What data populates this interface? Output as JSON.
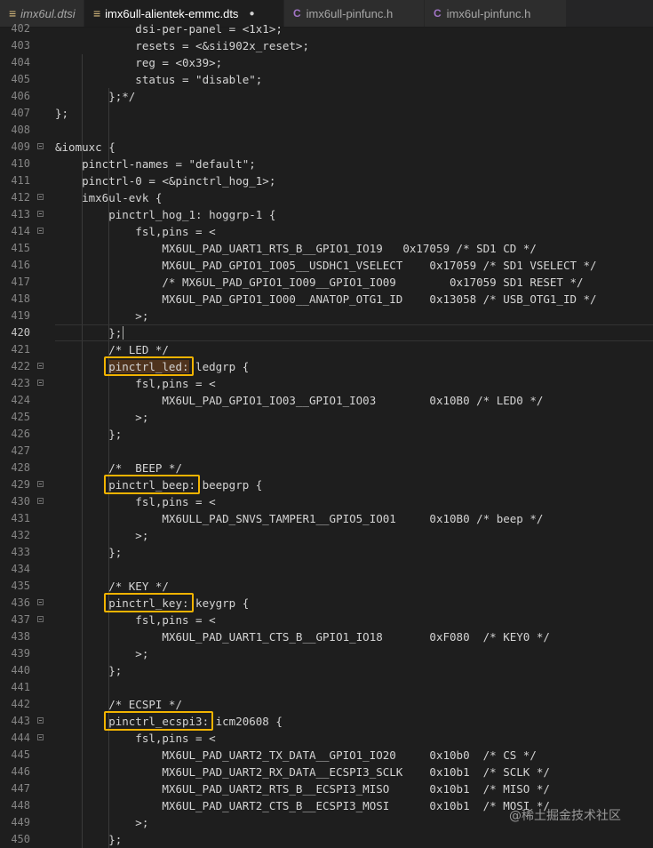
{
  "tabs": [
    {
      "label": "imx6ul.dtsi",
      "icon": "lines",
      "active": false,
      "italic": true
    },
    {
      "label": "imx6ull-alientek-emmc.dts",
      "icon": "lines",
      "active": true,
      "italic": false,
      "modified": true
    },
    {
      "label": "imx6ull-pinfunc.h",
      "icon": "c",
      "active": false,
      "italic": false
    },
    {
      "label": "imx6ul-pinfunc.h",
      "icon": "c",
      "active": false,
      "italic": false
    }
  ],
  "tab_icons": {
    "dts": "lines-icon",
    "header": "c-file-icon",
    "modified": "modified-dot-icon"
  },
  "editor": {
    "current_line": 420,
    "lines": [
      {
        "n": 402,
        "text": "            dsi-per-panel = <1x1>;"
      },
      {
        "n": 403,
        "text": "            resets = <&sii902x_reset>;"
      },
      {
        "n": 404,
        "text": "            reg = <0x39>;"
      },
      {
        "n": 405,
        "text": "            status = \"disable\";"
      },
      {
        "n": 406,
        "text": "        };*/"
      },
      {
        "n": 407,
        "text": "};"
      },
      {
        "n": 408,
        "text": ""
      },
      {
        "n": 409,
        "text": "&iomuxc {"
      },
      {
        "n": 410,
        "text": "    pinctrl-names = \"default\";"
      },
      {
        "n": 411,
        "text": "    pinctrl-0 = <&pinctrl_hog_1>;"
      },
      {
        "n": 412,
        "text": "    imx6ul-evk {"
      },
      {
        "n": 413,
        "text": "        pinctrl_hog_1: hoggrp-1 {"
      },
      {
        "n": 414,
        "text": "            fsl,pins = <"
      },
      {
        "n": 415,
        "text": "                MX6UL_PAD_UART1_RTS_B__GPIO1_IO19   0x17059 /* SD1 CD */"
      },
      {
        "n": 416,
        "text": "                MX6UL_PAD_GPIO1_IO05__USDHC1_VSELECT    0x17059 /* SD1 VSELECT */"
      },
      {
        "n": 417,
        "text": "                /* MX6UL_PAD_GPIO1_IO09__GPIO1_IO09        0x17059 SD1 RESET */"
      },
      {
        "n": 418,
        "text": "                MX6UL_PAD_GPIO1_IO00__ANATOP_OTG1_ID    0x13058 /* USB_OTG1_ID */"
      },
      {
        "n": 419,
        "text": "            >;"
      },
      {
        "n": 420,
        "text": "        };"
      },
      {
        "n": 421,
        "text": "        /* LED */"
      },
      {
        "n": 422,
        "text": "        pinctrl_led: ledgrp {"
      },
      {
        "n": 423,
        "text": "            fsl,pins = <"
      },
      {
        "n": 424,
        "text": "                MX6UL_PAD_GPIO1_IO03__GPIO1_IO03        0x10B0 /* LED0 */"
      },
      {
        "n": 425,
        "text": "            >;"
      },
      {
        "n": 426,
        "text": "        };"
      },
      {
        "n": 427,
        "text": ""
      },
      {
        "n": 428,
        "text": "        /*  BEEP */"
      },
      {
        "n": 429,
        "text": "        pinctrl_beep: beepgrp {"
      },
      {
        "n": 430,
        "text": "            fsl,pins = <"
      },
      {
        "n": 431,
        "text": "                MX6ULL_PAD_SNVS_TAMPER1__GPIO5_IO01     0x10B0 /* beep */"
      },
      {
        "n": 432,
        "text": "            >;"
      },
      {
        "n": 433,
        "text": "        };"
      },
      {
        "n": 434,
        "text": ""
      },
      {
        "n": 435,
        "text": "        /* KEY */"
      },
      {
        "n": 436,
        "text": "        pinctrl_key: keygrp {"
      },
      {
        "n": 437,
        "text": "            fsl,pins = <"
      },
      {
        "n": 438,
        "text": "                MX6UL_PAD_UART1_CTS_B__GPIO1_IO18       0xF080  /* KEY0 */"
      },
      {
        "n": 439,
        "text": "            >;"
      },
      {
        "n": 440,
        "text": "        };"
      },
      {
        "n": 441,
        "text": ""
      },
      {
        "n": 442,
        "text": "        /* ECSPI */"
      },
      {
        "n": 443,
        "text": "        pinctrl_ecspi3: icm20608 {"
      },
      {
        "n": 444,
        "text": "            fsl,pins = <"
      },
      {
        "n": 445,
        "text": "                MX6UL_PAD_UART2_TX_DATA__GPIO1_IO20     0x10b0  /* CS */"
      },
      {
        "n": 446,
        "text": "                MX6UL_PAD_UART2_RX_DATA__ECSPI3_SCLK    0x10b1  /* SCLK */"
      },
      {
        "n": 447,
        "text": "                MX6UL_PAD_UART2_RTS_B__ECSPI3_MISO      0x10b1  /* MISO */"
      },
      {
        "n": 448,
        "text": "                MX6UL_PAD_UART2_CTS_B__ECSPI3_MOSI      0x10b1  /* MOSI */"
      },
      {
        "n": 449,
        "text": "            >;"
      },
      {
        "n": 450,
        "text": "        };"
      }
    ],
    "fold_lines": [
      409,
      412,
      413,
      414,
      422,
      423,
      429,
      430,
      436,
      437,
      443,
      444
    ],
    "highlighted_labels": [
      {
        "line": 422,
        "label": "pinctrl_led"
      },
      {
        "line": 429,
        "label": "pinctrl_beep"
      },
      {
        "line": 436,
        "label": "pinctrl_key"
      },
      {
        "line": 443,
        "label": "pinctrl_ecspi3"
      }
    ]
  },
  "colors": {
    "highlight_border": "#f2b300",
    "background": "#1e1e1e"
  },
  "watermark": "@稀土掘金技术社区"
}
